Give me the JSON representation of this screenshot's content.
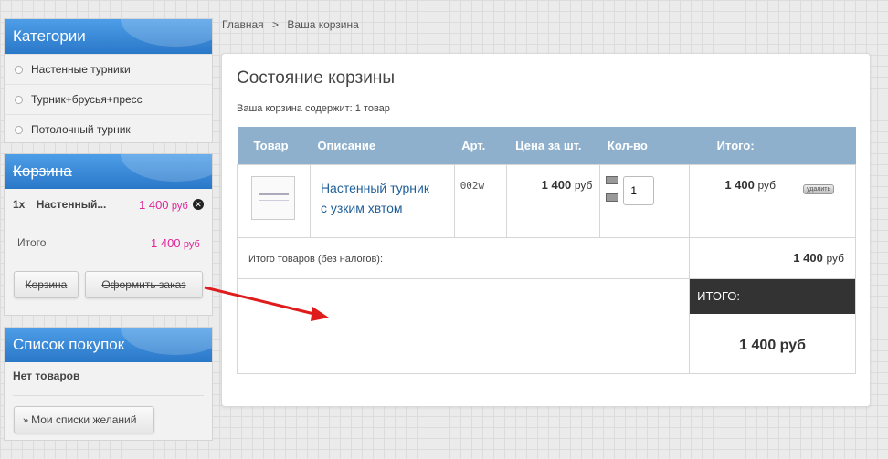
{
  "breadcrumb": {
    "home": "Главная",
    "sep": ">",
    "current": "Ваша корзина"
  },
  "categories": {
    "title": "Категории",
    "items": [
      {
        "label": "Настенные турники"
      },
      {
        "label": "Турник+брусья+пресс"
      },
      {
        "label": "Потолочный турник"
      }
    ]
  },
  "mini_cart": {
    "title": "Корзина",
    "item_qty": "1x",
    "item_name": "Настенный...",
    "item_price": "1 400",
    "item_currency": "руб",
    "total_label": "Итого",
    "total_price": "1 400",
    "total_currency": "руб",
    "cart_button": "Корзина",
    "checkout_button": "Оформить заказ"
  },
  "wishlist": {
    "title": "Список покупок",
    "empty_text": "Нет товаров",
    "button": "Мои списки желаний"
  },
  "cart": {
    "title": "Состояние корзины",
    "summary": "Ваша корзина содержит: 1 товар",
    "columns": [
      "Товар",
      "Описание",
      "Арт.",
      "Цена за шт.",
      "Кол-во",
      "Итого:"
    ],
    "row": {
      "name_line1": "Настенный турник",
      "name_line2": "с узким хвтом",
      "sku": "002w",
      "unit_price": "1 400",
      "unit_currency": "руб",
      "qty": "1",
      "total": "1 400",
      "total_currency": "руб",
      "delete": "удалить"
    },
    "subtotal_label": "Итого товаров (без налогов):",
    "subtotal_value": "1 400",
    "subtotal_currency": "руб",
    "grand_label": "ИТОГО:",
    "grand_value": "1 400 руб"
  },
  "colors": {
    "header_blue": "#2a78c8",
    "table_header": "#8eb0cd",
    "price_pink": "#e0249a",
    "link_blue": "#1f5f99",
    "arrow_red": "#e01b1b"
  }
}
